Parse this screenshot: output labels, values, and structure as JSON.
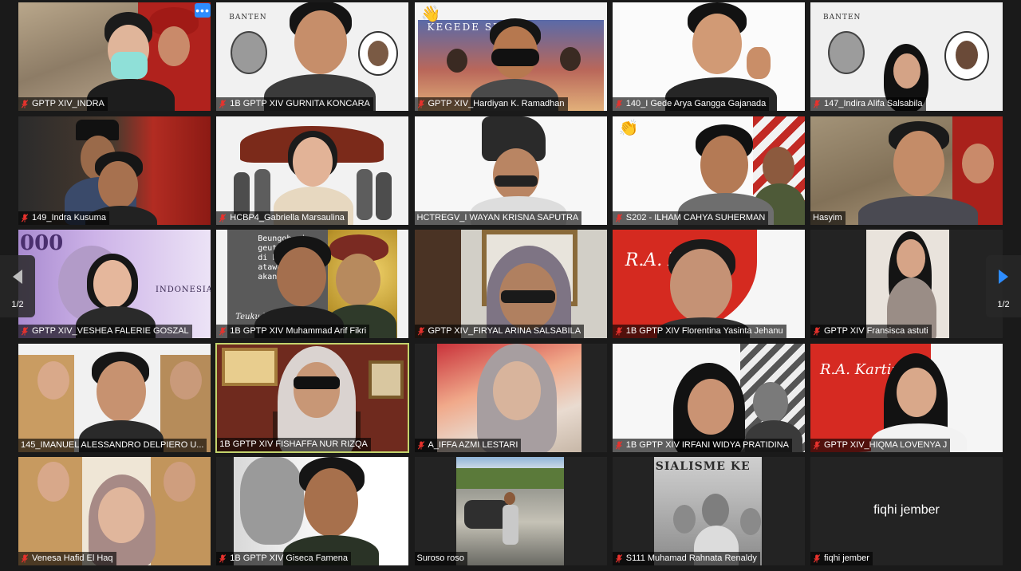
{
  "gallery": {
    "participants": [
      {
        "name": "GPTP XIV_INDRA",
        "muted": true
      },
      {
        "name": "1B GPTP XIV GURNITA KONCARA",
        "muted": true
      },
      {
        "name": "GPTP XIV_Hardiyan K. Ramadhan",
        "muted": true
      },
      {
        "name": "140_I Gede Arya Gangga Gajanada",
        "muted": true
      },
      {
        "name": "147_Indira Alifa Salsabila",
        "muted": true
      },
      {
        "name": "149_Indra Kusuma",
        "muted": true
      },
      {
        "name": "HCBP4_Gabriella Marsaulina",
        "muted": true
      },
      {
        "name": "HCTREGV_I WAYAN KRISNA SAPUTRA",
        "muted": false
      },
      {
        "name": "S202 - ILHAM CAHYA SUHERMAN",
        "muted": true
      },
      {
        "name": "Hasyim",
        "muted": false
      },
      {
        "name": "GPTP XIV_VESHEA FALERIE GOSZAL",
        "muted": true
      },
      {
        "name": "1B GPTP XIV Muhammad Arif Fikri",
        "muted": true
      },
      {
        "name": "GPTP XIV_FIRYAL ARINA SALSABILA",
        "muted": true
      },
      {
        "name": "1B GPTP XIV Florentina Yasinta Jehanu",
        "muted": true
      },
      {
        "name": "GPTP XIV Fransisca astuti",
        "muted": true
      },
      {
        "name": "145_IMANUEL ALESSANDRO DELPIERO U...",
        "muted": false
      },
      {
        "name": "1B GPTP XIV FISHAFFA NUR RIZQA",
        "muted": false
      },
      {
        "name": "A_IFFA AZMI LESTARI",
        "muted": true
      },
      {
        "name": "1B GPTP XIV IRFANI WIDYA PRATIDINA",
        "muted": true
      },
      {
        "name": "GPTP XIV_HIQMA LOVENYA J",
        "muted": true
      },
      {
        "name": "Venesa Hafid El Haq",
        "muted": true
      },
      {
        "name": "1B GPTP XIV Giseca Famena",
        "muted": true
      },
      {
        "name": "Suroso roso",
        "muted": false
      },
      {
        "name": "S111 Muhamad Rahnata Renaldy",
        "muted": true
      },
      {
        "name": "fiqhi jember",
        "muted": true
      }
    ],
    "no_video_display_name": "fiqhi jember"
  },
  "navigation": {
    "prev_page": "1/2",
    "next_page": "1/2"
  },
  "posters": {
    "banten": "BANTEN",
    "kegede": "KEGEDE SEBAYE",
    "teuku": "Teuku Uma",
    "kartini": "R.A. Kartini",
    "sialisme": "SIALISME KE",
    "currency": "000",
    "indonesia": "INDONESIA",
    "verse_1": "Beungoh si",
    "verse_2": "geutanyoe je",
    "verse_3": "di keude Me",
    "verse_4": "atawa s",
    "verse_5": "akan sy"
  },
  "colors": {
    "speaking_border": "#c3d36c",
    "accent_blue": "#2d8cff",
    "muted_red": "#e8322d"
  }
}
